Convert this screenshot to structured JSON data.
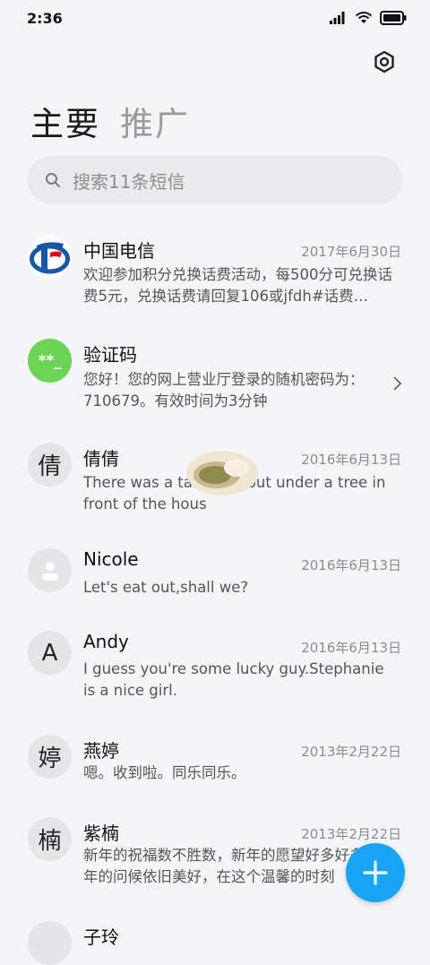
{
  "status_bar": {
    "time": "2:36"
  },
  "tabs": [
    {
      "label": "主要",
      "active": true
    },
    {
      "label": "推广",
      "active": false
    }
  ],
  "search": {
    "placeholder": "搜索11条短信"
  },
  "conversations": [
    {
      "avatar_type": "logo",
      "avatar_icon": "china-telecom-logo",
      "name": "中国电信",
      "date": "2017年6月30日",
      "preview": "欢迎参加积分兑换话费活动，每500分可兑换话费5元，兑换话费请回复106或jfdh#话费…"
    },
    {
      "avatar_type": "code",
      "avatar_text": "**_",
      "avatar_color": "#6cd454",
      "name": "验证码",
      "date": "",
      "preview": "您好！您的网上营业厅登录的随机密码为：710679。有效时间为3分钟"
    },
    {
      "avatar_type": "char",
      "avatar_text": "倩",
      "name": "倩倩",
      "date": "2016年6月13日",
      "preview": "There was a table set out under a tree in front of the hous"
    },
    {
      "avatar_type": "person",
      "avatar_icon": "person-icon",
      "name": "Nicole",
      "date": "2016年6月13日",
      "preview": "Let's eat out,shall we?"
    },
    {
      "avatar_type": "char",
      "avatar_text": "A",
      "name": "Andy",
      "date": "2016年6月13日",
      "preview": "I guess you're some lucky guy.Stephanie is a nice girl."
    },
    {
      "avatar_type": "char",
      "avatar_text": "婷",
      "name": "燕婷",
      "date": "2013年2月22日",
      "preview": "嗯。收到啦。同乐同乐。"
    },
    {
      "avatar_type": "char",
      "avatar_text": "楠",
      "name": "紫楠",
      "date": "2013年2月22日",
      "preview": "新年的祝福数不胜数，新年的愿望好多好多，新年的问候依旧美好，在这个温馨的时刻"
    },
    {
      "avatar_type": "char",
      "avatar_text": "",
      "name": "子玲",
      "date": "",
      "preview": ""
    }
  ],
  "fab": {
    "icon": "plus-icon",
    "color": "#19a4f5"
  }
}
